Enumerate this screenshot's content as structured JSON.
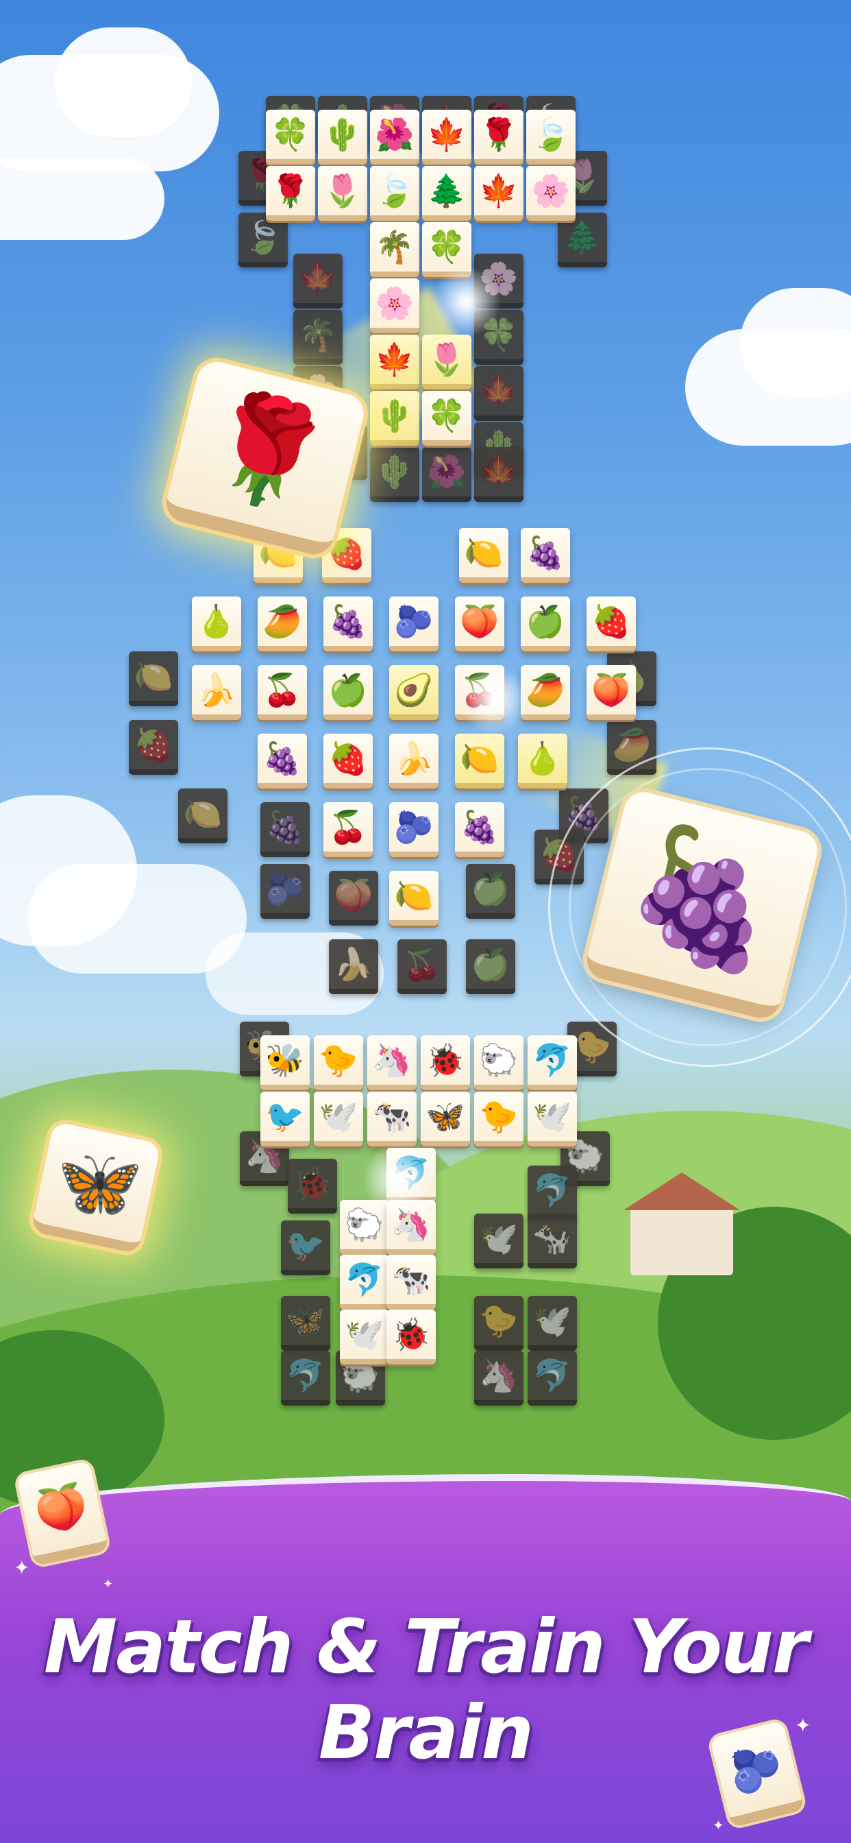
{
  "headline": "Match & Train Your Brain",
  "colors": {
    "sky_top": "#3f86dd",
    "banner_purple": "#9a46d6",
    "tile_face": "#fffdf5",
    "tile_edge": "#d9b98a",
    "glow": "#fff07a"
  },
  "boards": {
    "plants": {
      "top_tiles": [
        "🍀",
        "🌵",
        "🌺",
        "🍁",
        "🌹",
        "🍃",
        "🌹",
        "🌷",
        "🍃",
        "🌲",
        "🍁",
        "🌸",
        "🌴",
        "🍀",
        "🌸",
        "🍁",
        "🌷",
        "🌵"
      ],
      "icon_theme": "plants-and-flowers"
    },
    "fruits": {
      "top_tiles": [
        "🍋",
        "🍓",
        "🍋",
        "🍇",
        "🍐",
        "🥭",
        "🍇",
        "🫐",
        "🍑",
        "🍏",
        "🍓",
        "🍌",
        "🍒",
        "🍏",
        "🥑",
        "🍒",
        "🥭",
        "🍑",
        "🍇",
        "🍓",
        "🍌",
        "🍋",
        "🍐",
        "🍒",
        "🫐",
        "🍇"
      ],
      "icon_theme": "fruits"
    },
    "animals": {
      "top_tiles": [
        "🐝",
        "🐤",
        "🦄",
        "🐞",
        "🐑",
        "🐬",
        "🐦",
        "🕊️",
        "🐄",
        "🦋",
        "🐤",
        "🕊️",
        "🐬",
        "🐑",
        "🦄",
        "🐬",
        "🐄",
        "🕊️",
        "🐞"
      ],
      "icon_theme": "animals"
    }
  },
  "featured_tiles": {
    "rose": "🌹",
    "grapes": "🍇",
    "butterfly": "🦋",
    "peach": "🍑",
    "blueberry": "🫐"
  }
}
